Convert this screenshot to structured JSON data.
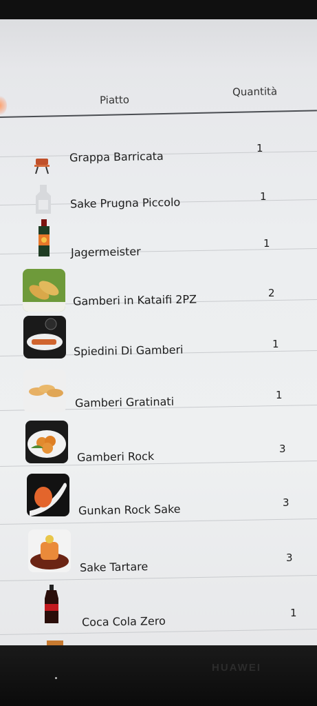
{
  "header": {
    "dish_col": "Piatto",
    "qty_col": "Quantità"
  },
  "items": [
    {
      "name": "Grappa Barricata",
      "qty": "1",
      "icon": "grappa-glass-icon"
    },
    {
      "name": "Sake Prugna Piccolo",
      "qty": "1",
      "icon": "sake-bottle-icon"
    },
    {
      "name": "Jagermeister",
      "qty": "1",
      "icon": "jagermeister-bottle-icon"
    },
    {
      "name": "Gamberi in Kataifi 2PZ",
      "qty": "2",
      "icon": "kataifi-shrimp-photo"
    },
    {
      "name": "Spiedini Di Gamberi",
      "qty": "1",
      "icon": "shrimp-skewer-photo"
    },
    {
      "name": "Gamberi Gratinati",
      "qty": "1",
      "icon": "gratin-shrimp-photo"
    },
    {
      "name": "Gamberi Rock",
      "qty": "3",
      "icon": "rock-shrimp-photo"
    },
    {
      "name": "Gunkan Rock Sake",
      "qty": "3",
      "icon": "gunkan-photo"
    },
    {
      "name": "Sake Tartare",
      "qty": "3",
      "icon": "tartare-photo"
    },
    {
      "name": "Coca Cola Zero",
      "qty": "1",
      "icon": "coke-bottle-icon"
    }
  ],
  "device": {
    "brand": "HUAWEI"
  }
}
